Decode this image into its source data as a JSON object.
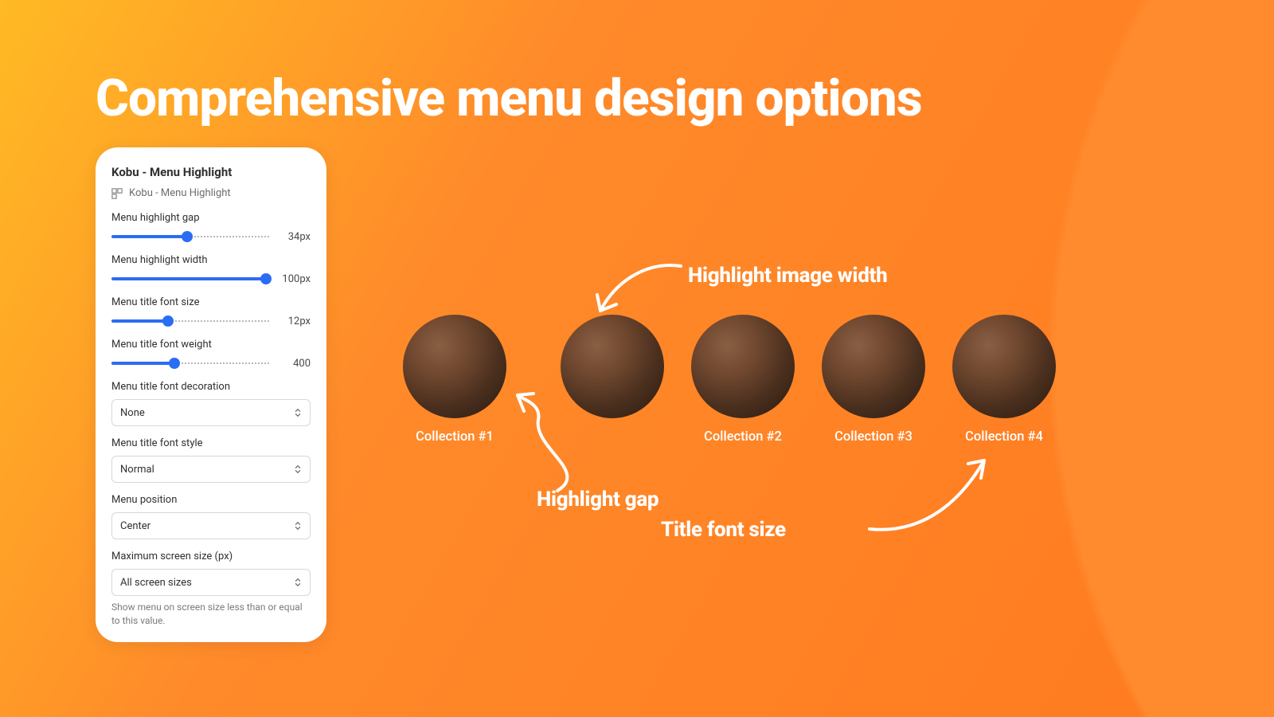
{
  "headline": "Comprehensive menu design options",
  "panel": {
    "title": "Kobu - Menu Highlight",
    "subtitle": "Kobu - Menu Highlight",
    "sliders": [
      {
        "label": "Menu highlight gap",
        "value": "34px",
        "fill_pct": 48
      },
      {
        "label": "Menu highlight width",
        "value": "100px",
        "fill_pct": 98
      },
      {
        "label": "Menu title font size",
        "value": "12px",
        "fill_pct": 36
      },
      {
        "label": "Menu title font weight",
        "value": "400",
        "fill_pct": 40
      }
    ],
    "selects": [
      {
        "label": "Menu title font decoration",
        "value": "None"
      },
      {
        "label": "Menu title font style",
        "value": "Normal"
      },
      {
        "label": "Menu position",
        "value": "Center"
      },
      {
        "label": "Maximum screen size (px)",
        "value": "All screen sizes",
        "help": "Show menu on screen size less than or equal to this value."
      }
    ]
  },
  "preview": {
    "items": [
      {
        "label": "Collection #1"
      },
      {
        "label": ""
      },
      {
        "label": "Collection #2"
      },
      {
        "label": "Collection #3"
      },
      {
        "label": "Collection #4"
      }
    ]
  },
  "annotations": {
    "image_width": "Highlight image width",
    "gap": "Highlight gap",
    "font_size": "Title font size"
  }
}
